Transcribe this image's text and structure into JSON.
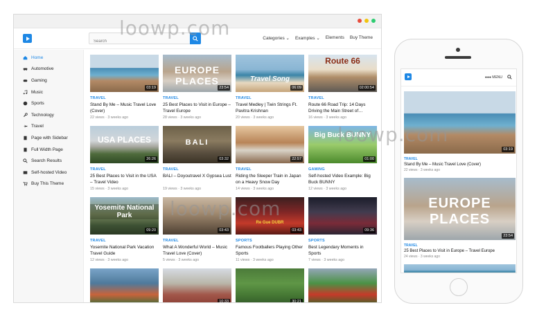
{
  "browser": {
    "dot_colors": [
      "#e74c3c",
      "#f1c40f",
      "#2ecc71"
    ],
    "search": {
      "placeholder": "Search"
    },
    "nav": [
      "Categories ⌄",
      "Examples ⌄",
      "Elements",
      "Buy Theme"
    ]
  },
  "sidebar": {
    "items": [
      {
        "label": "Home",
        "icon": "home-icon",
        "active": true
      },
      {
        "label": "Automotive",
        "icon": "car-icon"
      },
      {
        "label": "Gaming",
        "icon": "gamepad-icon"
      },
      {
        "label": "Music",
        "icon": "music-icon"
      },
      {
        "label": "Sports",
        "icon": "ball-icon"
      },
      {
        "label": "Technology",
        "icon": "wrench-icon"
      },
      {
        "label": "Travel",
        "icon": "plane-icon"
      },
      {
        "label": "Page with Sidebar",
        "icon": "page-icon"
      },
      {
        "label": "Full Width Page",
        "icon": "page-icon"
      },
      {
        "label": "Search Results",
        "icon": "search-icon"
      },
      {
        "label": "Self-hosted Video",
        "icon": "video-icon"
      },
      {
        "label": "Buy This Theme",
        "icon": "cart-icon"
      }
    ]
  },
  "videos": [
    {
      "category": "TRAVEL",
      "title": "Stand By Me – Music Travel Love (Cover)",
      "views": "22 views",
      "age": "3 weeks ago",
      "duration": "03:19",
      "overlay": ""
    },
    {
      "category": "TRAVEL",
      "title": "25 Best Places to Visit in Europe – Travel Europe",
      "views": "28 views",
      "age": "3 weeks ago",
      "duration": "23:54",
      "overlay": "EUROPE PLACES"
    },
    {
      "category": "TRAVEL",
      "title": "Travel Medley | Twin Strings Ft. Pavitra Krishnan",
      "views": "20 views",
      "age": "3 weeks ago",
      "duration": "06:09",
      "overlay": "Travel Song"
    },
    {
      "category": "TRAVEL",
      "title": "Route 66 Road Trip: 14 Days Driving the Main Street of…",
      "views": "16 views",
      "age": "3 weeks ago",
      "duration": "02:00:54",
      "overlay": "Route 66"
    },
    {
      "category": "TRAVEL",
      "title": "25 Best Places to Visit in the USA – Travel Video",
      "views": "15 views",
      "age": "3 weeks ago",
      "duration": "26:26",
      "overlay": "USA PLACES"
    },
    {
      "category": "TRAVEL",
      "title": "BALI – Doyoutravel X Gypsea Lust",
      "views": "19 views",
      "age": "3 weeks ago",
      "duration": "03:32",
      "overlay": "BALI"
    },
    {
      "category": "TRAVEL",
      "title": "Riding the Sleeper Train in Japan on a Heavy Snow Day",
      "views": "14 views",
      "age": "3 weeks ago",
      "duration": "22:57",
      "overlay": ""
    },
    {
      "category": "GAMING",
      "title": "Self-hosted Video Example: Big Buck BUNNY",
      "views": "12 views",
      "age": "3 weeks ago",
      "duration": "01:00",
      "overlay": "Big Buck BUNNY"
    },
    {
      "category": "TRAVEL",
      "title": "Yosemite National Park Vacation Travel Guide",
      "views": "12 views",
      "age": "3 weeks ago",
      "duration": "09:20",
      "overlay": "Yosemite National Park"
    },
    {
      "category": "TRAVEL",
      "title": "What A Wonderful World – Music Travel Love (Cover)",
      "views": "5 views",
      "age": "3 weeks ago",
      "duration": "03:43",
      "overlay": ""
    },
    {
      "category": "SPORTS",
      "title": "Famous Footballers Playing Other Sports",
      "views": "11 views",
      "age": "3 weeks ago",
      "duration": "03:43",
      "overlay": "Re Gue DUBR"
    },
    {
      "category": "SPORTS",
      "title": "Best Legendary Moments in Sports",
      "views": "7 views",
      "age": "3 weeks ago",
      "duration": "09:36",
      "overlay": ""
    },
    {
      "category": "",
      "title": "",
      "views": "",
      "age": "",
      "duration": "",
      "overlay": ""
    },
    {
      "category": "",
      "title": "",
      "views": "",
      "age": "",
      "duration": "10:33",
      "overlay": ""
    },
    {
      "category": "",
      "title": "",
      "views": "",
      "age": "",
      "duration": "30:21",
      "overlay": ""
    },
    {
      "category": "",
      "title": "",
      "views": "",
      "age": "",
      "duration": "",
      "overlay": ""
    }
  ],
  "mobile": {
    "menu": "●●● MENU",
    "cards": [
      {
        "category": "TRAVEL",
        "title": "Stand By Me – Music Travel Love (Cover)",
        "meta": "22 views  ·  3 weeks ago",
        "duration": "03:19",
        "overlay": ""
      },
      {
        "category": "TRAVEL",
        "title": "25 Best Places to Visit in Europe – Travel Europe",
        "meta": "24 views  ·  3 weeks ago",
        "duration": "23:54",
        "overlay": "EUROPE PLACES"
      }
    ]
  },
  "watermark": "loowp.com"
}
